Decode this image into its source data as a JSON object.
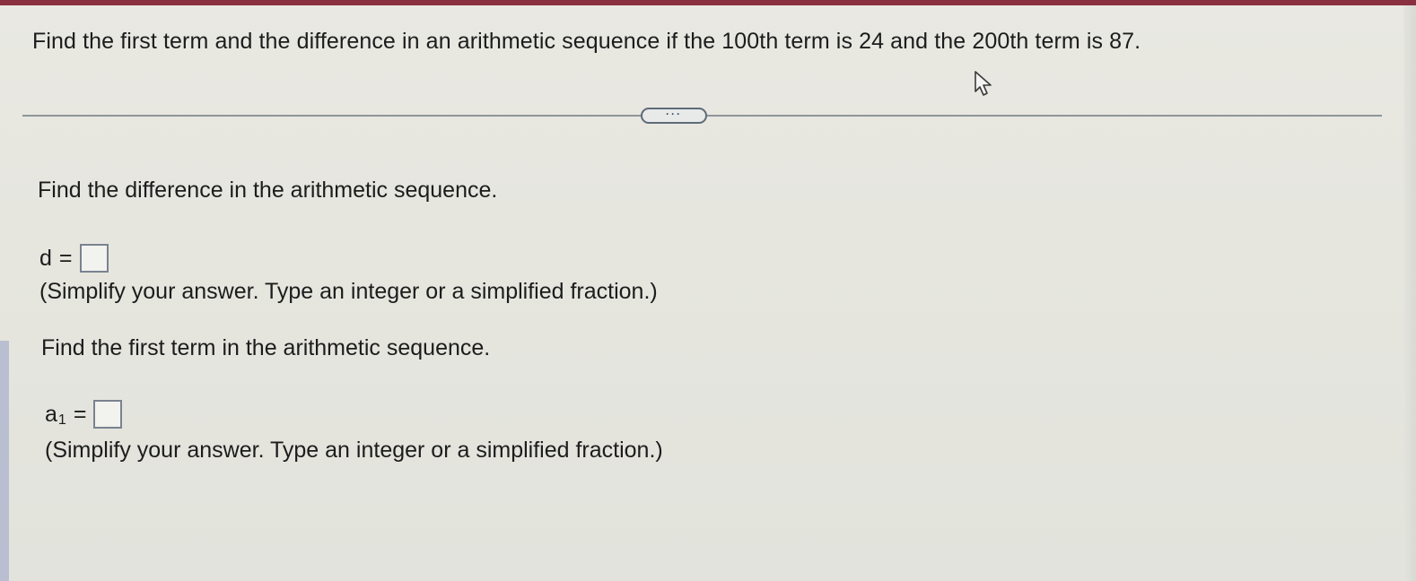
{
  "question": {
    "text": "Find the first term and the difference in an arithmetic sequence if the 100th term is 24 and the 200th term is 87."
  },
  "expand_button": {
    "label": "···"
  },
  "part1": {
    "prompt": "Find the difference in the arithmetic sequence.",
    "variable": "d",
    "equals": "=",
    "value": "",
    "hint": "(Simplify your answer. Type an integer or a simplified fraction.)"
  },
  "part2": {
    "prompt": "Find the first term in the arithmetic sequence.",
    "variable": "a",
    "subscript": "1",
    "equals": "=",
    "value": "",
    "hint": "(Simplify your answer. Type an integer or a simplified fraction.)"
  },
  "colors": {
    "top_bar": "#8a2f3f",
    "background": "#e7e7e0",
    "divider": "#8d9599",
    "button_border": "#5f6b78"
  },
  "icons": {
    "cursor": "mouse-pointer-icon",
    "expand": "ellipsis-icon"
  }
}
